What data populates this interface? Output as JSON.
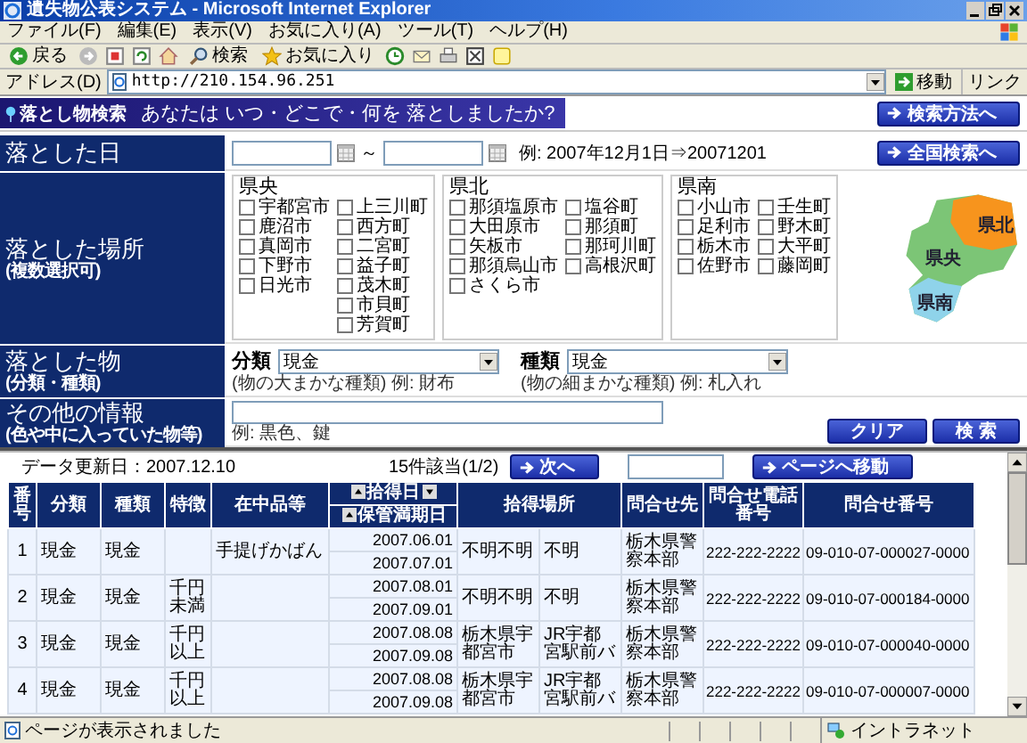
{
  "window": {
    "title": "遺失物公表システム - Microsoft Internet Explorer"
  },
  "menu": [
    "ファイル(F)",
    "編集(E)",
    "表示(V)",
    "お気に入り(A)",
    "ツール(T)",
    "ヘルプ(H)"
  ],
  "toolbar": [
    {
      "kind": "back",
      "label": "戻る"
    },
    {
      "kind": "search",
      "label": "検索"
    },
    {
      "kind": "favorites",
      "label": "お気に入り"
    }
  ],
  "address": {
    "label": "アドレス(D)",
    "value": "http://210.154.96.251",
    "go": "移動",
    "links": "リンク"
  },
  "banner": {
    "logo": "落とし物検索",
    "question": "あなたは いつ・どこで・何を 落としましたか?",
    "help_button": "検索方法へ"
  },
  "date": {
    "label": "落とした日",
    "separator": "～",
    "example": "例: 2007年12月1日⇒20071201",
    "national_button": "全国検索へ"
  },
  "place": {
    "label": "落とした場所",
    "sublabel": "(複数選択可)",
    "regions": [
      {
        "name": "県央",
        "columns": [
          [
            {
              "label": "宇都宮市",
              "checked": false
            },
            {
              "label": "鹿沼市",
              "checked": false
            },
            {
              "label": "真岡市",
              "checked": false
            },
            {
              "label": "下野市",
              "checked": false
            },
            {
              "label": "日光市",
              "checked": false
            }
          ],
          [
            {
              "label": "上三川町",
              "checked": false
            },
            {
              "label": "西方町",
              "checked": false
            },
            {
              "label": "二宮町",
              "checked": false
            },
            {
              "label": "益子町",
              "checked": false
            },
            {
              "label": "茂木町",
              "checked": false
            },
            {
              "label": "市貝町",
              "checked": false
            },
            {
              "label": "芳賀町",
              "checked": false
            }
          ]
        ]
      },
      {
        "name": "県北",
        "columns": [
          [
            {
              "label": "那須塩原市",
              "checked": false
            },
            {
              "label": "大田原市",
              "checked": false
            },
            {
              "label": "矢板市",
              "checked": false
            },
            {
              "label": "那須烏山市",
              "checked": false
            },
            {
              "label": "さくら市",
              "checked": false
            }
          ],
          [
            {
              "label": "塩谷町",
              "checked": false
            },
            {
              "label": "那須町",
              "checked": false
            },
            {
              "label": "那珂川町",
              "checked": false
            },
            {
              "label": "高根沢町",
              "checked": false
            }
          ]
        ]
      },
      {
        "name": "県南",
        "columns": [
          [
            {
              "label": "小山市",
              "checked": false
            },
            {
              "label": "足利市",
              "checked": false
            },
            {
              "label": "栃木市",
              "checked": false
            },
            {
              "label": "佐野市",
              "checked": false
            }
          ],
          [
            {
              "label": "壬生町",
              "checked": false
            },
            {
              "label": "野木町",
              "checked": false
            },
            {
              "label": "大平町",
              "checked": false
            },
            {
              "label": "藤岡町",
              "checked": false
            }
          ]
        ]
      }
    ],
    "map_labels": [
      "県北",
      "県央",
      "県南"
    ]
  },
  "item": {
    "label": "落とした物",
    "sublabel": "(分類・種類)",
    "category": {
      "label": "分類",
      "value": "現金",
      "hint": "(物の大まかな種類)  例: 財布"
    },
    "type": {
      "label": "種類",
      "value": "現金",
      "hint": "(物の細まかな種類)  例: 札入れ"
    }
  },
  "other": {
    "label": "その他の情報",
    "sublabel": "(色や中に入っていた物等)",
    "example": "例: 黒色、鍵",
    "clear_button": "クリア",
    "search_button": "検 索"
  },
  "results": {
    "updated": "データ更新日：2007.12.10",
    "count": "15件該当(1/2)",
    "next_button": "次へ",
    "page_button": "ページへ移動"
  },
  "table": {
    "columns": [
      "番号",
      "分類",
      "種類",
      "特徴",
      "在中品等",
      "拾得日",
      "保管満期日",
      "拾得場所",
      "問合せ先",
      "問合せ電話番号",
      "問合せ番号"
    ],
    "rows": [
      {
        "number": "1",
        "category": "現金",
        "type": "現金",
        "contents": "手提げかばん",
        "found_date": "2007.06.01",
        "expiry_date": "2007.07.01",
        "place": "不明不明",
        "place_detail": "不明",
        "contact": "栃木県警察本部",
        "phone": "222-222-2222",
        "reference": "09-010-07-000027-0000"
      },
      {
        "number": "2",
        "category": "現金",
        "type": "現金",
        "feature": "千円未満",
        "found_date": "2007.08.01",
        "expiry_date": "2007.09.01",
        "place": "不明不明",
        "place_detail": "不明",
        "contact": "栃木県警察本部",
        "phone": "222-222-2222",
        "reference": "09-010-07-000184-0000"
      },
      {
        "number": "3",
        "category": "現金",
        "type": "現金",
        "feature": "千円以上",
        "found_date": "2007.08.08",
        "expiry_date": "2007.09.08",
        "place": "栃木県宇都宮市",
        "place_detail": "JR宇都宮駅前バ",
        "contact": "栃木県警察本部",
        "phone": "222-222-2222",
        "reference": "09-010-07-000040-0000"
      },
      {
        "number": "4",
        "category": "現金",
        "type": "現金",
        "feature": "千円以上",
        "found_date": "2007.08.08",
        "expiry_date": "2007.09.08",
        "place": "栃木県宇都宮市",
        "place_detail": "JR宇都宮駅前バ",
        "contact": "栃木県警察本部",
        "phone": "222-222-2222",
        "reference": "09-010-07-000007-0000"
      }
    ]
  },
  "status": {
    "message": "ページが表示されました",
    "zone": "イントラネット"
  }
}
